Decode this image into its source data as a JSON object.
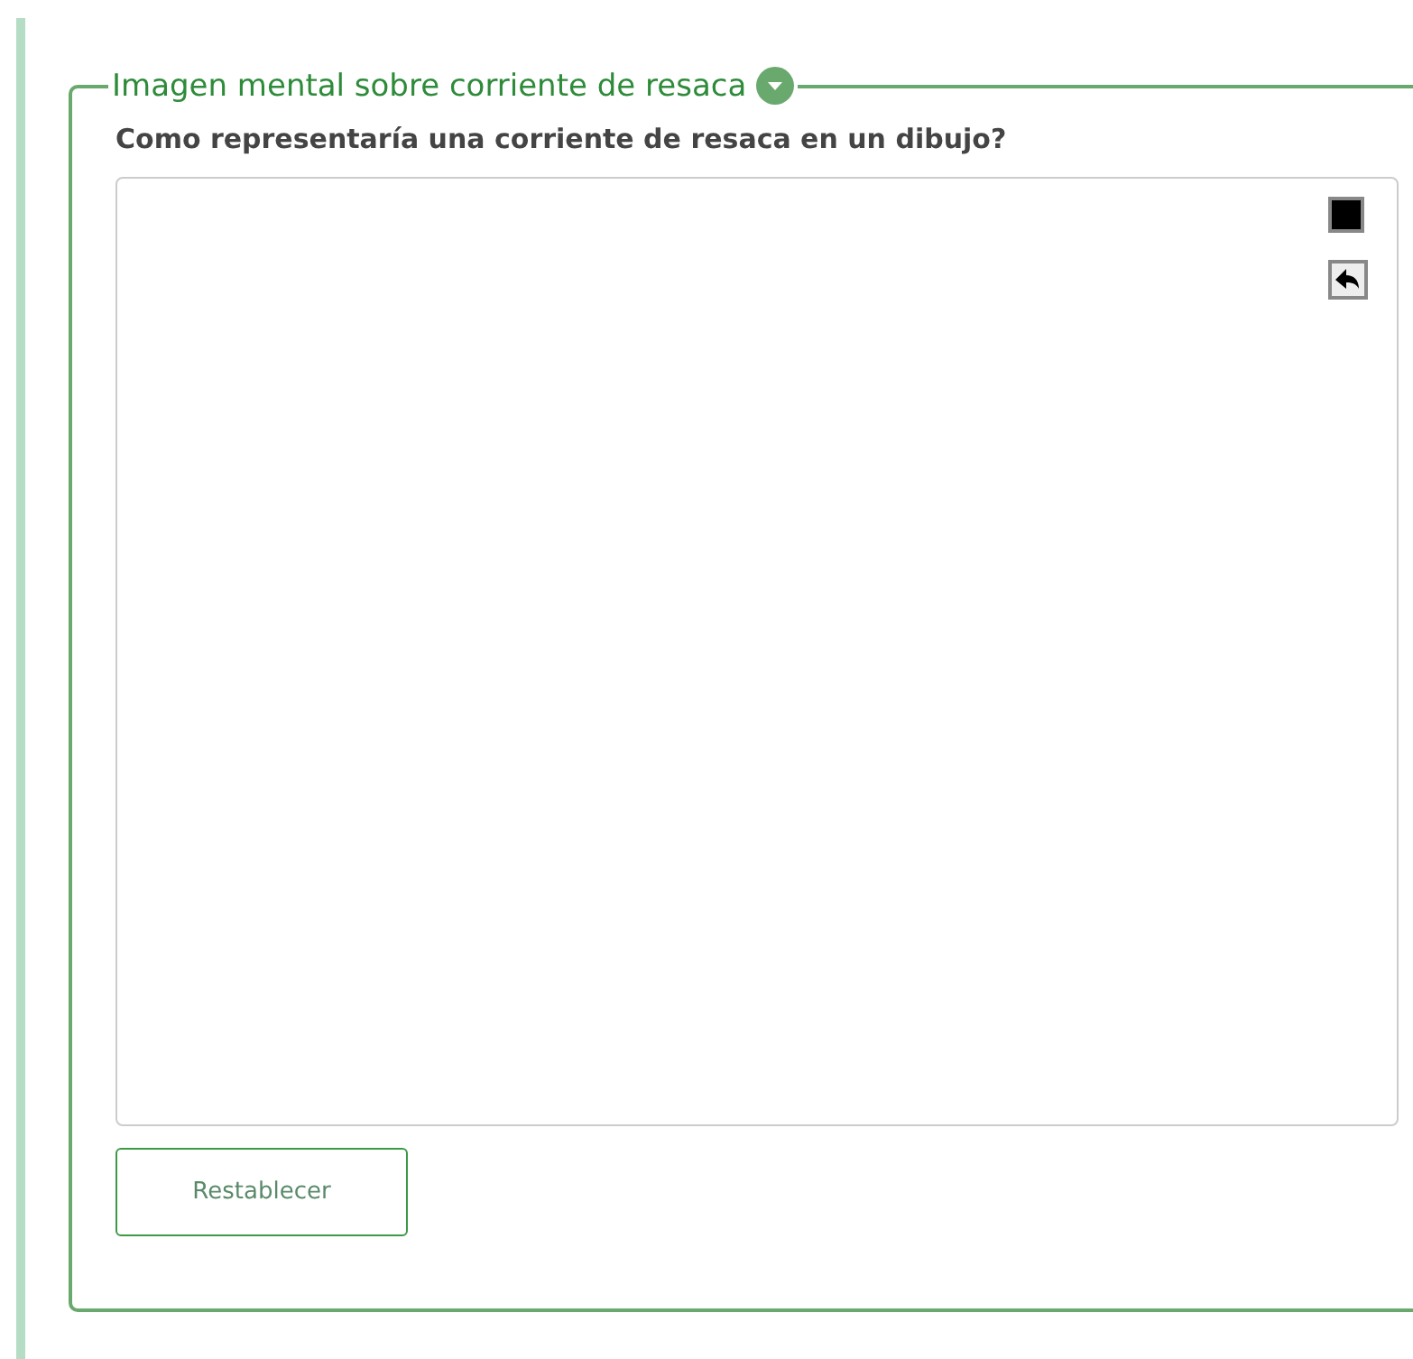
{
  "section": {
    "title": "Imagen mental sobre corriente de resaca"
  },
  "question": "Como representaría una corriente de resaca en un dibujo?",
  "buttons": [
    {
      "label": "Restablecer"
    }
  ]
}
